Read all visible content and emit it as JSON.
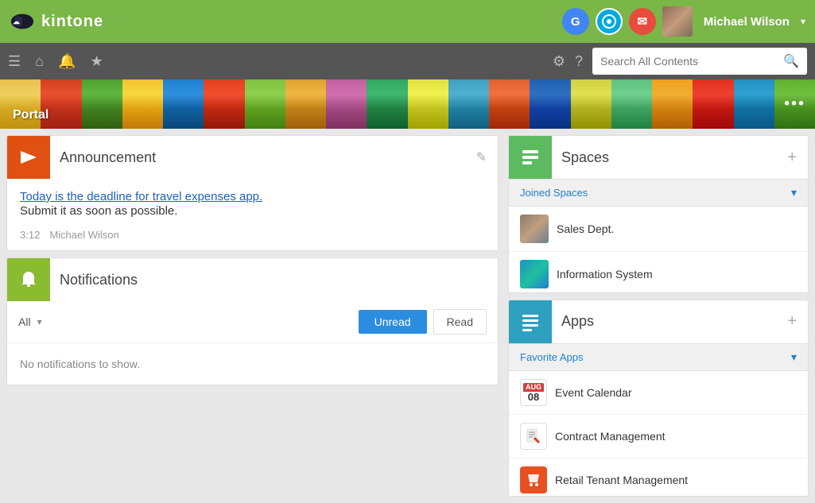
{
  "topbar": {
    "logo_text": "kintone",
    "user_name": "Michael Wilson",
    "apps": [
      {
        "key": "G",
        "label": "Google",
        "color": "google"
      },
      {
        "key": "O",
        "label": "Other",
        "color": "blue"
      },
      {
        "key": "✉",
        "label": "Mail",
        "color": "mail"
      }
    ]
  },
  "navbar": {
    "search_placeholder": "Search All Contents"
  },
  "portal": {
    "label": "Portal",
    "more": "•••"
  },
  "announcement": {
    "title": "Announcement",
    "body_link": "Today is the deadline for travel expenses app.",
    "body_text": "Submit it as soon as possible.",
    "time": "3:12",
    "author": "Michael Wilson",
    "edit_icon": "✎"
  },
  "notifications": {
    "title": "Notifications",
    "filter_label": "All",
    "btn_unread": "Unread",
    "btn_read": "Read",
    "empty_message": "No notifications to show."
  },
  "spaces": {
    "title": "Spaces",
    "subheader": "Joined Spaces",
    "add_icon": "+",
    "items": [
      {
        "name": "Sales Dept.",
        "type": "sales"
      },
      {
        "name": "Information System",
        "type": "info"
      }
    ]
  },
  "apps": {
    "title": "Apps",
    "subheader": "Favorite Apps",
    "add_icon": "+",
    "items": [
      {
        "name": "Event Calendar",
        "type": "calendar",
        "label": "08"
      },
      {
        "name": "Contract Management",
        "type": "contract"
      },
      {
        "name": "Retail Tenant Management",
        "type": "retail"
      }
    ]
  }
}
